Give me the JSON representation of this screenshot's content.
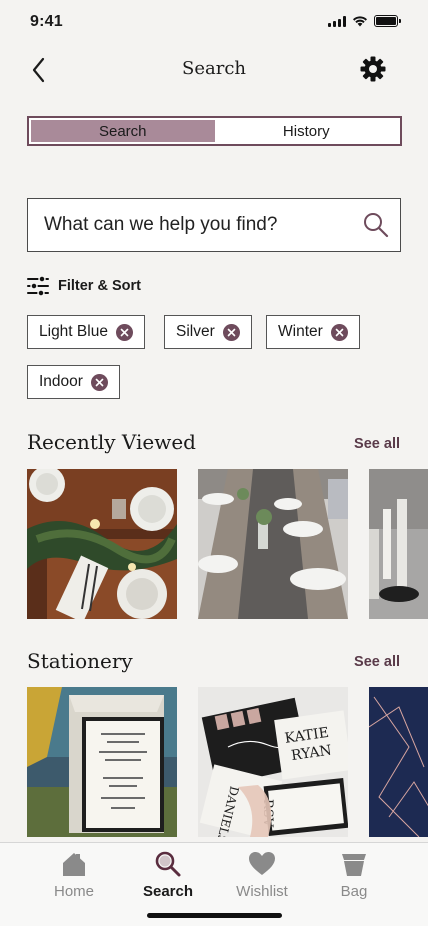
{
  "status_bar": {
    "time": "9:41"
  },
  "header": {
    "title": "Search"
  },
  "segments": [
    {
      "label": "Search",
      "active": true
    },
    {
      "label": "History",
      "active": false
    }
  ],
  "search": {
    "placeholder": "What can we help you find?"
  },
  "filter": {
    "label": "Filter & Sort"
  },
  "chips": [
    "Light Blue",
    "Silver",
    "Winter",
    "Indoor"
  ],
  "sections": {
    "recent": {
      "title": "Recently Viewed",
      "see_all": "See all"
    },
    "stationery": {
      "title": "Stationery",
      "see_all": "See all"
    }
  },
  "stationery_card_text": {
    "couple": "KATIE & RYAN",
    "couple_line1": "KATIE",
    "couple_line2": "RYAN",
    "name_fragment": "RSV",
    "initials": "DANIELS"
  },
  "tab_bar": [
    {
      "label": "Home",
      "icon": "home-icon",
      "active": false
    },
    {
      "label": "Search",
      "icon": "search-icon",
      "active": true
    },
    {
      "label": "Wishlist",
      "icon": "heart-icon",
      "active": false
    },
    {
      "label": "Bag",
      "icon": "bag-icon",
      "active": false
    }
  ],
  "colors": {
    "accent": "#6e4b5c",
    "segment_active": "#a98a99",
    "background": "#f4f3f1"
  }
}
